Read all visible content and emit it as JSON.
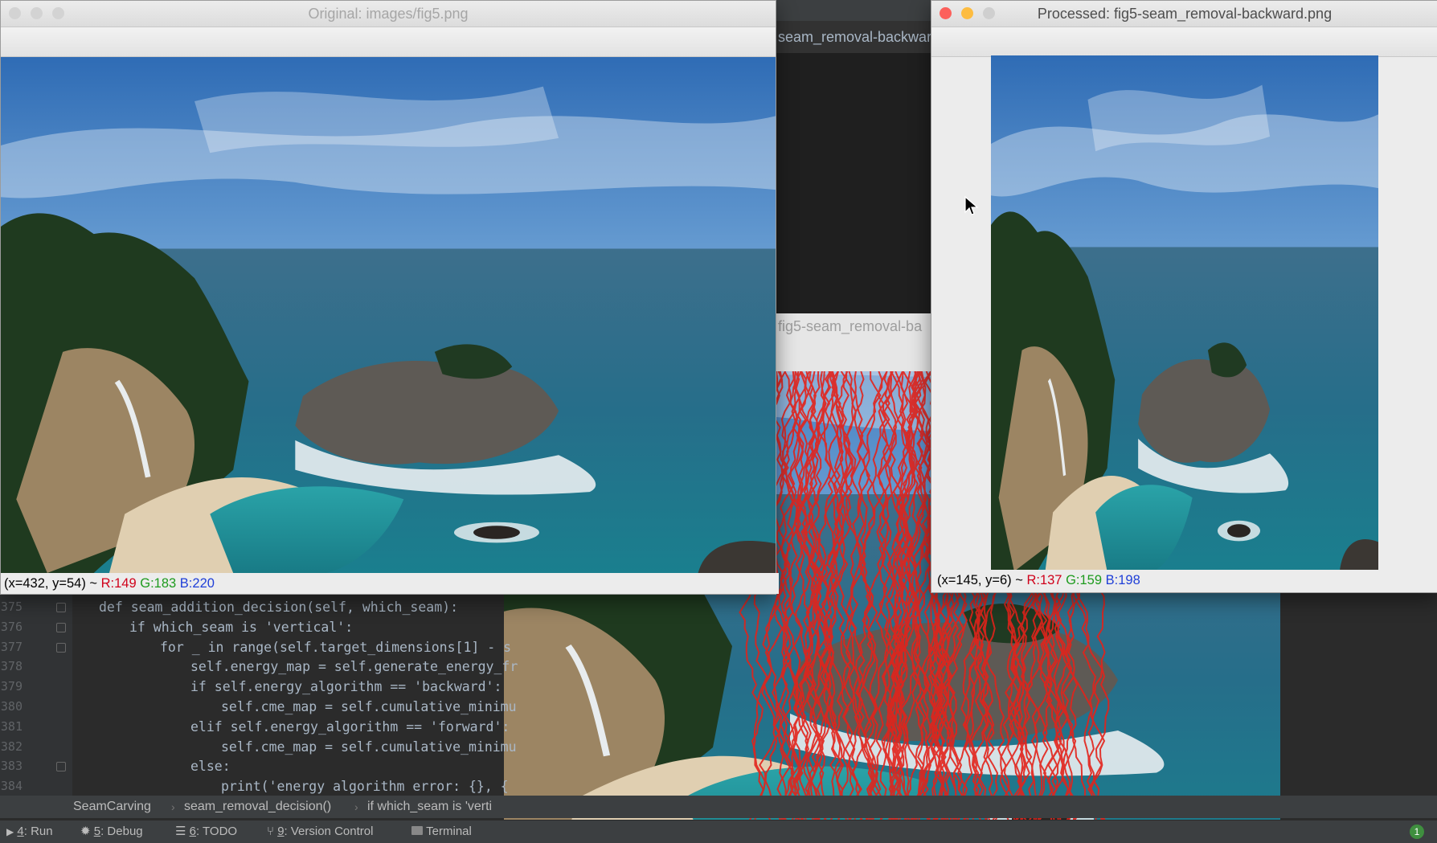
{
  "ide": {
    "tab_top": "seam_removal-backwar",
    "tab_middle": "fig5-seam_removal-ba",
    "code_lines": [
      {
        "n": "375",
        "text": "def seam_addition_decision(self, which_seam):"
      },
      {
        "n": "376",
        "text": "if which_seam is 'vertical':"
      },
      {
        "n": "377",
        "text": "for _ in range(self.target_dimensions[1] - s"
      },
      {
        "n": "378",
        "text": "self.energy_map = self.generate_energy_fr"
      },
      {
        "n": "379",
        "text": "if self.energy_algorithm == 'backward':"
      },
      {
        "n": "380",
        "text": "self.cme_map = self.cumulative_minimu"
      },
      {
        "n": "381",
        "text": "elif self.energy_algorithm == 'forward':"
      },
      {
        "n": "382",
        "text": "self.cme_map = self.cumulative_minimu"
      },
      {
        "n": "383",
        "text": "else:"
      },
      {
        "n": "384",
        "text": "print('energy algorithm error: {}, {"
      }
    ],
    "breadcrumb": [
      "SeamCarving",
      "seam_removal_decision()",
      "if which_seam is 'verti"
    ],
    "tools": [
      {
        "key": "4",
        "label": ": Run"
      },
      {
        "key": "5",
        "label": ": Debug"
      },
      {
        "key": "6",
        "label": ": TODO"
      },
      {
        "key": "9",
        "label": ": Version Control"
      },
      {
        "key": "",
        "label": "Terminal"
      }
    ],
    "notification_count": "1"
  },
  "window_original": {
    "title": "Original: images/fig5.png",
    "status_coords": "(x=432, y=54) ~ ",
    "status_r": "R:149",
    "status_g": "G:183",
    "status_b": "B:220"
  },
  "window_processed": {
    "title": "Processed: fig5-seam_removal-backward.png",
    "status_coords": "(x=145, y=6) ~ ",
    "status_r": "R:137",
    "status_g": "G:159",
    "status_b": "B:198"
  },
  "colors": {
    "r_color": "#d0021b",
    "g_color": "#1e9b1e",
    "b_color": "#1f3fd8",
    "close": "#fc605b",
    "minimize": "#fdbc40",
    "zoom": "#cfcfcf",
    "seam_red": "#e3231b"
  }
}
